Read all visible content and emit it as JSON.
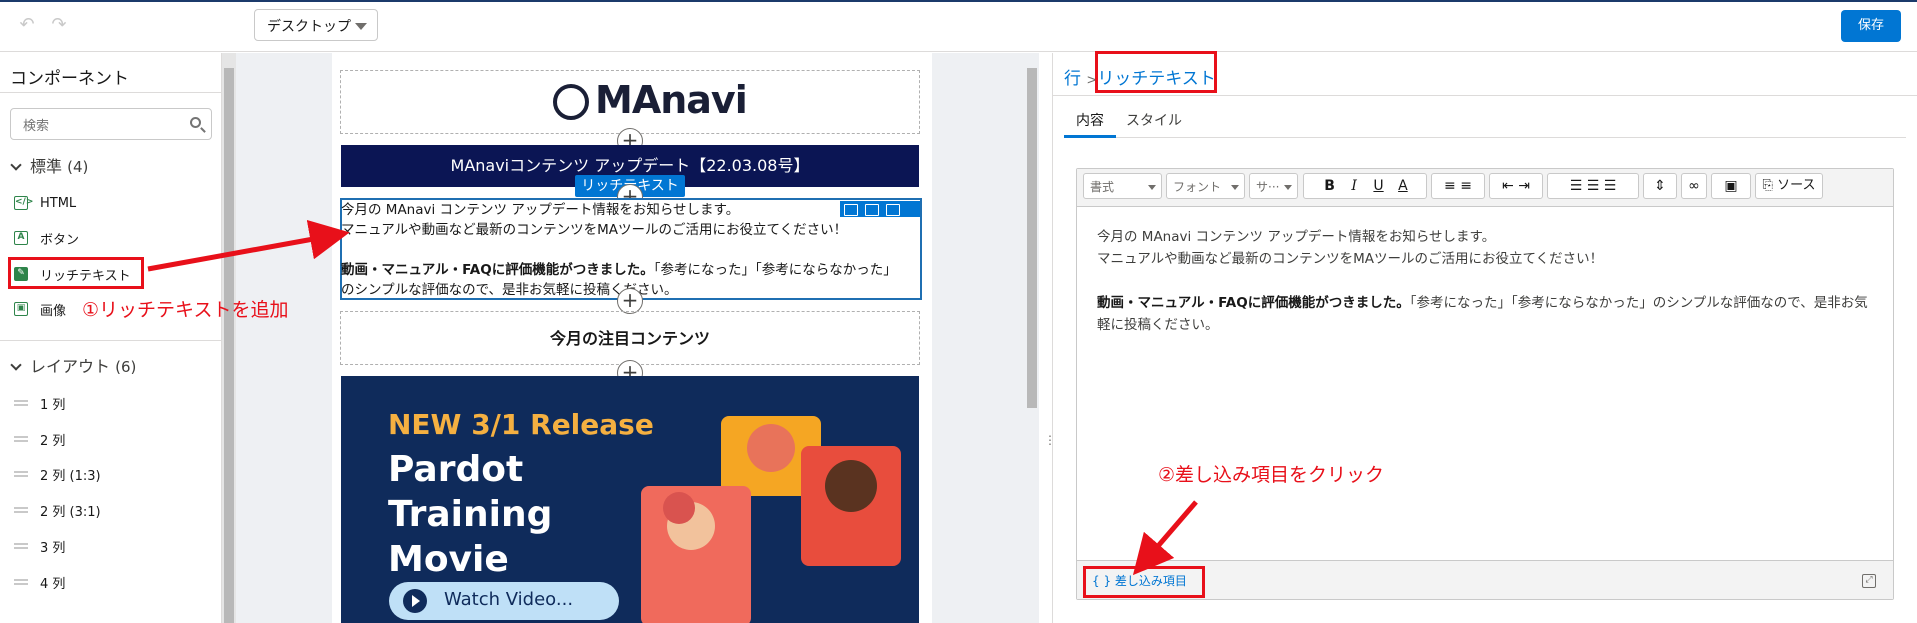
{
  "topbar": {
    "device_select": "デスクトップ",
    "save_label": "保存"
  },
  "left_panel": {
    "title": "コンポーネント",
    "search_placeholder": "検索",
    "standard_section": {
      "label": "標準",
      "count": "(4)"
    },
    "standard_items": [
      "HTML",
      "ボタン",
      "リッチテキスト",
      "画像"
    ],
    "layout_section": {
      "label": "レイアウト",
      "count": "(6)"
    },
    "layout_items": [
      "1 列",
      "2 列",
      "2 列 (1:3)",
      "2 列 (3:1)",
      "3 列",
      "4 列"
    ]
  },
  "canvas": {
    "logo_text": "MAnavi",
    "title_bar": "MAnaviコンテンツ アップデート【22.03.08号】",
    "rich_text_tag": "リッチテキスト",
    "rich_text_line1": "今月の MAnavi コンテンツ アップデート情報をお知らせします。",
    "rich_text_line2": "マニュアルや動画など最新のコンテンツをMAツールのご活用にお役立てください！",
    "rich_text_bold": "動画・マニュアル・FAQに評価機能がつきました。",
    "rich_text_rest": "「参考になった」「参考にならなかった」のシンプルな評価なので、是非お気軽に投稿ください。",
    "featured_heading": "今月の注目コンテンツ",
    "promo_release": "NEW  3/1 Release",
    "promo_title_1": "Pardot",
    "promo_title_2": "Training",
    "promo_title_3": "Movie",
    "watch_label": "Watch Video..."
  },
  "right_panel": {
    "crumb_parent": "行",
    "crumb_sep": ">",
    "crumb_current": "リッチテキスト",
    "tabs": [
      "内容",
      "スタイル"
    ],
    "toolbar": {
      "format": "書式",
      "font": "フォント",
      "size": "サ···",
      "bold": "B",
      "italic": "I",
      "underline": "U",
      "color": "A",
      "source": "ソース"
    },
    "editor_line1": "今月の MAnavi コンテンツ アップデート情報をお知らせします。",
    "editor_line2": "マニュアルや動画など最新のコンテンツをMAツールのご活用にお役立てください！",
    "editor_bold": "動画・マニュアル・FAQに評価機能がつきました。",
    "editor_rest": "「参考になった」「参考にならなかった」のシンプルな評価なので、是非お気軽に投稿ください。",
    "merge_fields": "差し込み項目"
  },
  "annotations": {
    "step1": "①リッチテキストを追加",
    "step2": "②差し込み項目をクリック",
    "color": "#e8101a"
  }
}
